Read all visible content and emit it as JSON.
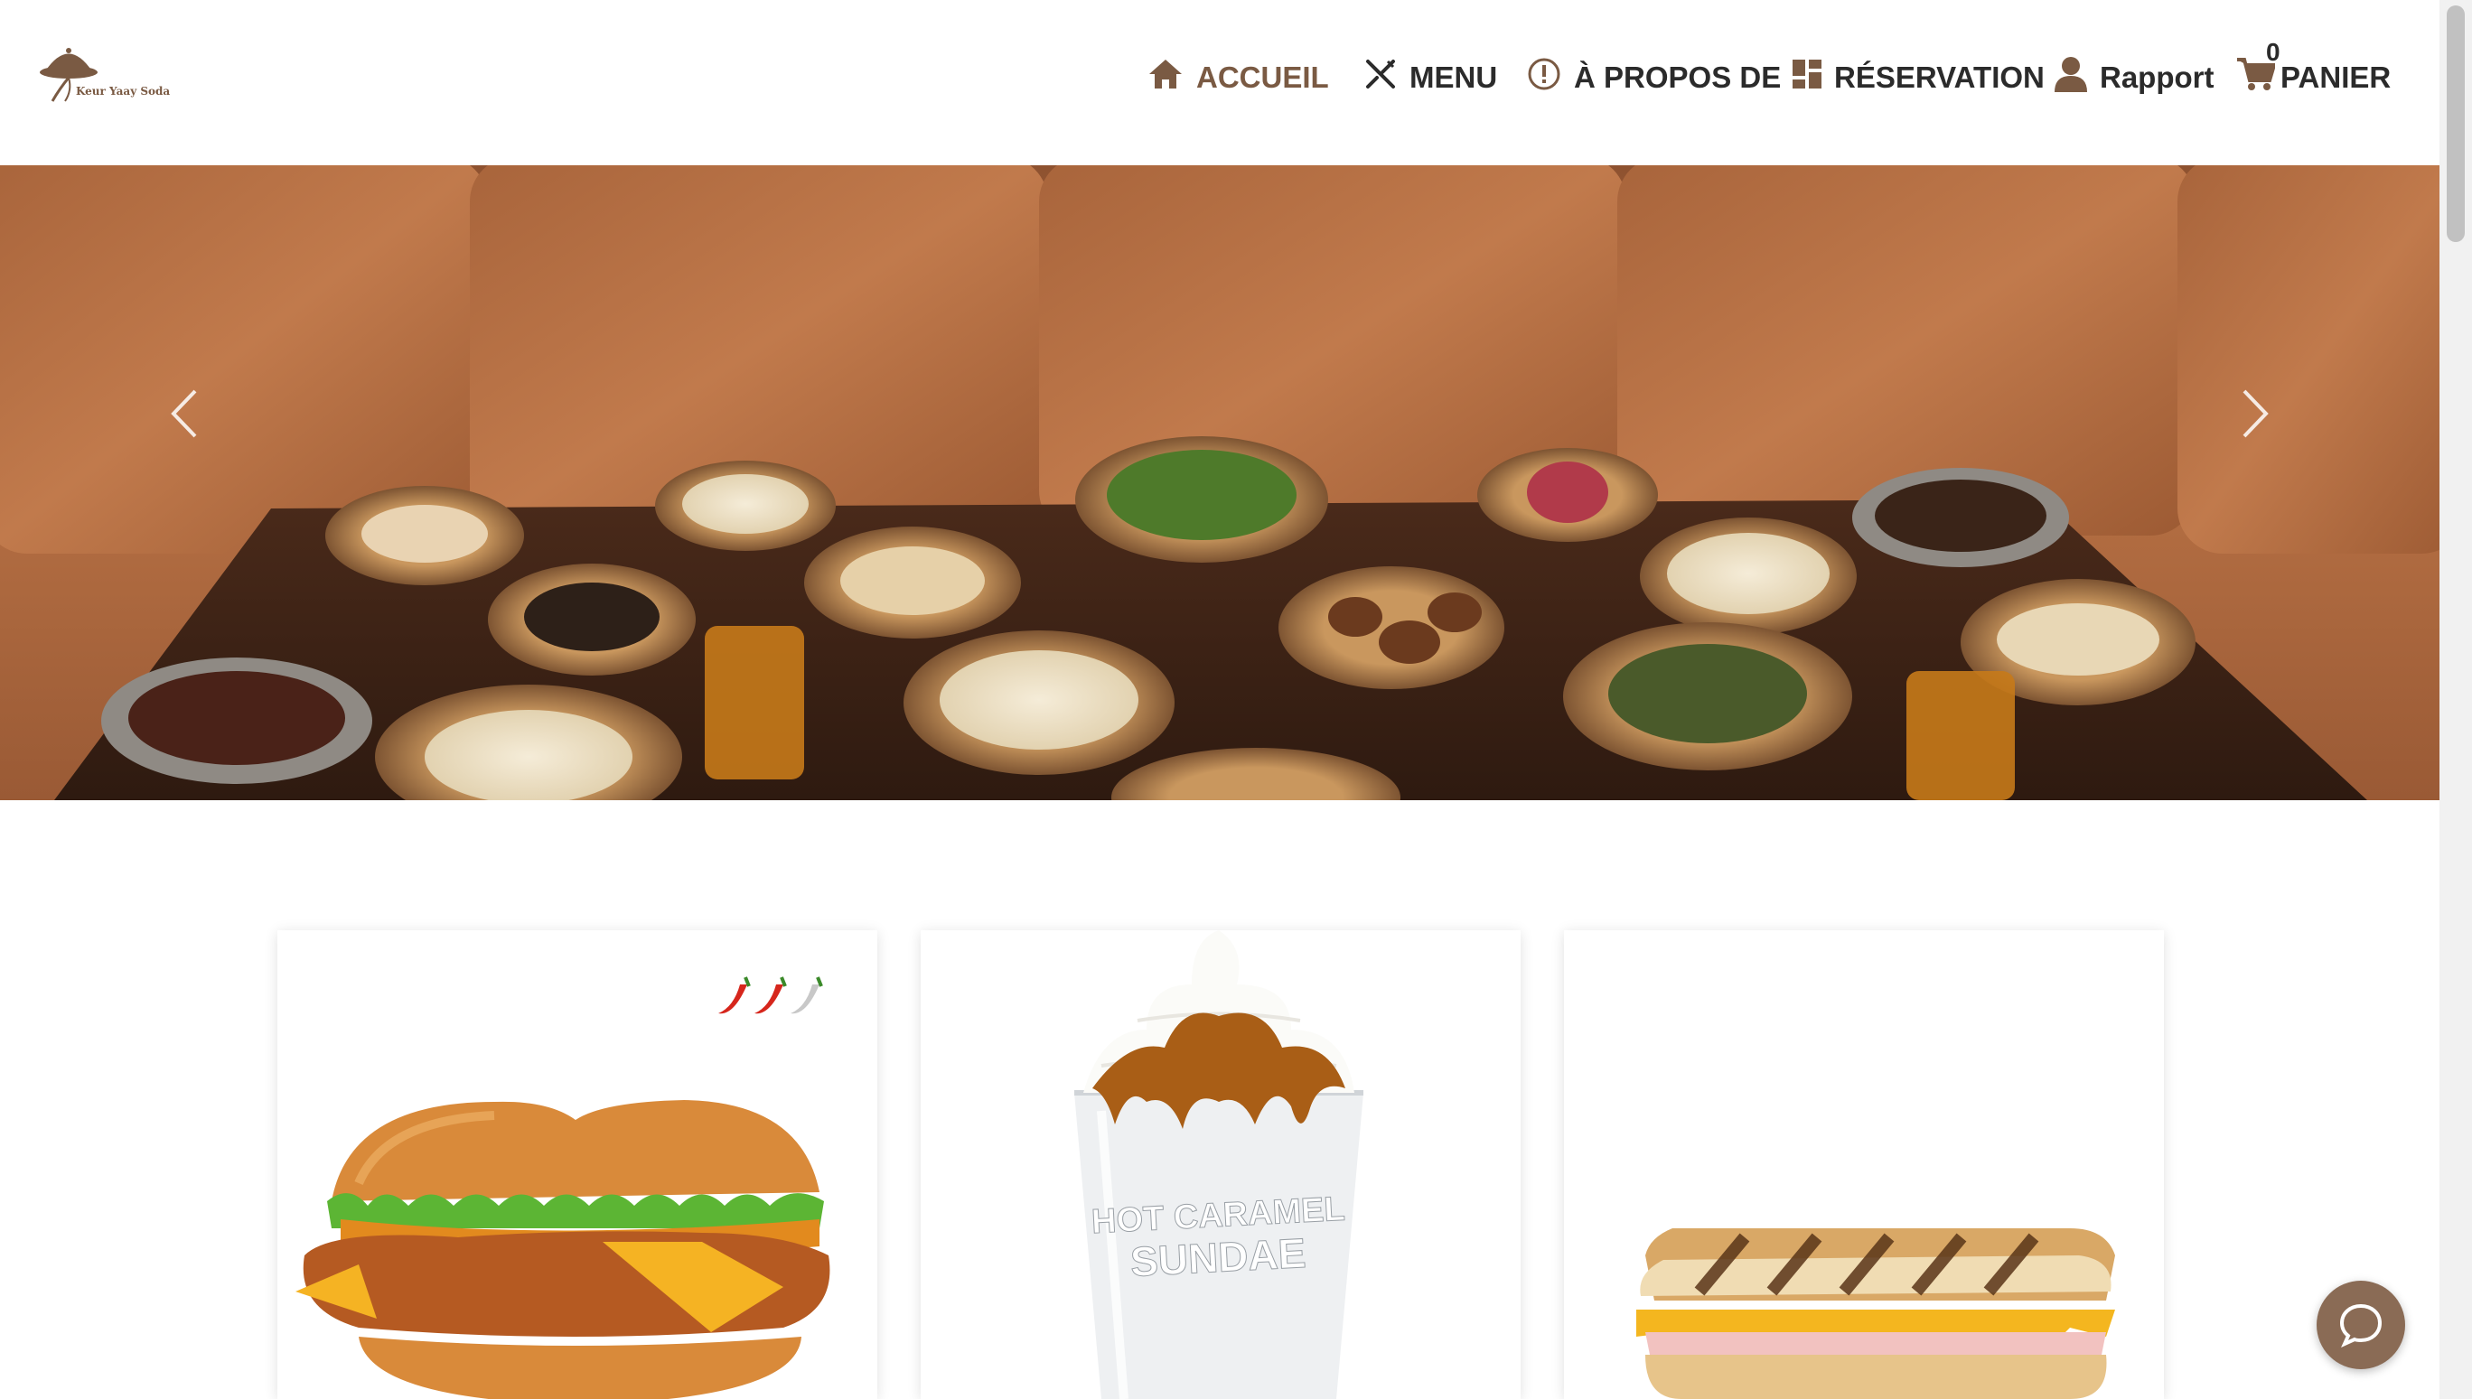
{
  "brand": {
    "name": "Keur Yaay Soda"
  },
  "nav": {
    "home": "ACCUEIL",
    "menu": "MENU",
    "about": "À PROPOS DE",
    "reservation": "RÉSERVATION",
    "report": "Rapport",
    "cart": "PANIER",
    "cart_count": "0"
  },
  "icons": {
    "home": "home-icon",
    "menu": "fork-knife-icon",
    "about": "info-circle-icon",
    "reservation": "grid-icon",
    "report": "user-icon",
    "cart": "cart-icon",
    "prev": "chevron-left-icon",
    "next": "chevron-right-icon",
    "chat": "chat-icon"
  },
  "cards": [
    {
      "name": "spicy-chicken-burger",
      "spice_level": "2 of 3"
    },
    {
      "name": "hot-caramel-sundae",
      "cup_text_line1": "HOT CARAMEL",
      "cup_text_line2": "SUNDAE"
    },
    {
      "name": "grilled-cheese-sandwich"
    }
  ],
  "colors": {
    "brand_brown": "#7a5a43",
    "chat_button": "#8a6b55",
    "text_dark": "#2b2b2b"
  }
}
